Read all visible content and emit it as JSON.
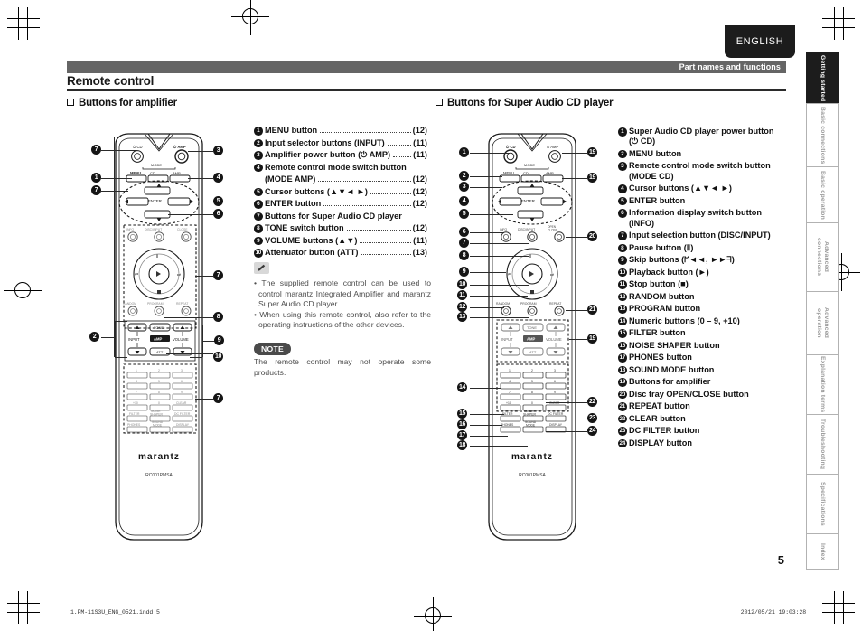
{
  "document": {
    "language_tab": "ENGLISH",
    "header_strip_label": "Part names and functions",
    "section_title": "Remote control",
    "page_number": "5",
    "footer_left": "1.PM-11S3U_ENG_0521.indd   5",
    "footer_right": "2012/05/21   19:03:28",
    "colors": {
      "header_strip": "#656565",
      "tab_active": "#1c1c1c",
      "bullet": "#151515",
      "note_badge": "#4a4a4a",
      "body_text": "#4e4e4e"
    }
  },
  "left_column": {
    "heading": "Buttons for amplifier",
    "items": [
      {
        "n": "1",
        "text": "MENU button",
        "page": "(12)",
        "leader": true
      },
      {
        "n": "2",
        "text": "Input selector buttons (INPUT)",
        "page": "(11)",
        "leader": true
      },
      {
        "n": "3",
        "text": "Amplifier power button (⏻ AMP)",
        "page": "(11)",
        "leader": true
      },
      {
        "n": "4",
        "text": "Remote control mode switch button",
        "page": "",
        "leader": false,
        "cont": "(MODE AMP)",
        "cont_page": "(12)",
        "cont_leader": true
      },
      {
        "n": "5",
        "text": "Cursor buttons (▲▼◄ ►)",
        "page": "(12)",
        "leader": true
      },
      {
        "n": "6",
        "text": "ENTER button",
        "page": "(12)",
        "leader": true
      },
      {
        "n": "7",
        "text": "Buttons for Super Audio CD player",
        "page": "",
        "leader": false
      },
      {
        "n": "8",
        "text": "TONE switch button",
        "page": "(12)",
        "leader": true
      },
      {
        "n": "9",
        "text": "VOLUME buttons (▲▼)",
        "page": "(11)",
        "leader": true
      },
      {
        "n": "10",
        "text": "Attenuator button (ATT)",
        "page": "(13)",
        "leader": true
      }
    ],
    "tip_bullets": [
      "• The supplied remote control can be used to control marantz Integrated Amplifier and marantz Super Audio CD player.",
      "• When using this remote control, also refer to the operating instructions of the other devices."
    ],
    "note_label": "NOTE",
    "note_text": "The remote control may not operate some products."
  },
  "right_column": {
    "heading": "Buttons for Super Audio CD player",
    "items": [
      {
        "n": "1",
        "text": "Super Audio CD player power button",
        "cont": "(⏻  CD)"
      },
      {
        "n": "2",
        "text": "MENU button"
      },
      {
        "n": "3",
        "text": "Remote control mode switch button",
        "cont": "(MODE CD)"
      },
      {
        "n": "4",
        "text": "Cursor buttons (▲▼◄ ►)"
      },
      {
        "n": "5",
        "text": "ENTER button"
      },
      {
        "n": "6",
        "text": "Information display switch button",
        "cont": "(INFO)"
      },
      {
        "n": "7",
        "text": "Input selection button (DISC/INPUT)"
      },
      {
        "n": "8",
        "text": "Pause button (Ⅱ)"
      },
      {
        "n": "9",
        "text": "Skip buttons (ᖸ◄◄, ►►ᖷ)"
      },
      {
        "n": "10",
        "text": "Playback button (►)"
      },
      {
        "n": "11",
        "text": "Stop button (■)"
      },
      {
        "n": "12",
        "text": "RANDOM button"
      },
      {
        "n": "13",
        "text": "PROGRAM button"
      },
      {
        "n": "14",
        "text": "Numeric buttons (0 – 9, +10)"
      },
      {
        "n": "15",
        "text": "FILTER button"
      },
      {
        "n": "16",
        "text": "NOISE SHAPER button"
      },
      {
        "n": "17",
        "text": "PHONES button"
      },
      {
        "n": "18",
        "text": "SOUND MODE button"
      },
      {
        "n": "19",
        "text": "Buttons for amplifier"
      },
      {
        "n": "20",
        "text": "Disc tray OPEN/CLOSE button"
      },
      {
        "n": "21",
        "text": "REPEAT button"
      },
      {
        "n": "22",
        "text": "CLEAR button"
      },
      {
        "n": "23",
        "text": "DC FILTER button"
      },
      {
        "n": "24",
        "text": "DISPLAY button"
      }
    ]
  },
  "remote_amp": {
    "brand": "marantz",
    "model": "RC001PMSA",
    "labels": {
      "power_cd": "⏻ CD",
      "power_amp": "⏻ AMP",
      "mode": "MODE",
      "mode_cd": "CD",
      "mode_amp": "AMP",
      "menu": "MENU",
      "enter": "ENTER",
      "info": "INFO",
      "disc_input": "DISC/INPUT",
      "open_close": "OPEN/CLOSE",
      "random": "RANDOM",
      "program": "PROGRAM",
      "repeat": "REPEAT",
      "tone": "TONE",
      "input": "INPUT",
      "amp": "AMP",
      "volume": "VOLUME",
      "att": "ATT",
      "clear": "CLEAR",
      "filter": "FILTER",
      "noise_shaper": "NOISE SHAPER",
      "dc_filter": "DC FILTER",
      "phones": "PHONES",
      "sound_mode": "SOUND MODE",
      "display": "DISPLAY",
      "keys": [
        "1",
        "2",
        "3",
        "4",
        "5",
        "6",
        "7",
        "8",
        "9",
        "+10",
        "0"
      ]
    },
    "callouts_left": [
      "7",
      "1",
      "7",
      "2"
    ],
    "callouts_right": [
      "3",
      "4",
      "5",
      "6",
      "7",
      "8",
      "9",
      "10",
      "7"
    ]
  },
  "remote_cd": {
    "brand": "marantz",
    "model": "RC001PMSA",
    "callouts_left": [
      "1",
      "2",
      "3",
      "4",
      "5",
      "6",
      "7",
      "8",
      "9",
      "10",
      "11",
      "12",
      "13",
      "14",
      "15",
      "16",
      "17",
      "18"
    ],
    "callouts_right": [
      "19",
      "19",
      "20",
      "21",
      "19",
      "22",
      "23",
      "24"
    ]
  },
  "side_tabs": [
    {
      "label": "Getting started",
      "active": true
    },
    {
      "label": "Basic connections",
      "active": false
    },
    {
      "label": "Basic operation",
      "active": false
    },
    {
      "label": "Advanced connections",
      "active": false
    },
    {
      "label": "Advanced operation",
      "active": false
    },
    {
      "label": "Explanation terms",
      "active": false
    },
    {
      "label": "Troubleshooting",
      "active": false
    },
    {
      "label": "Specifications",
      "active": false
    },
    {
      "label": "Index",
      "active": false
    }
  ]
}
